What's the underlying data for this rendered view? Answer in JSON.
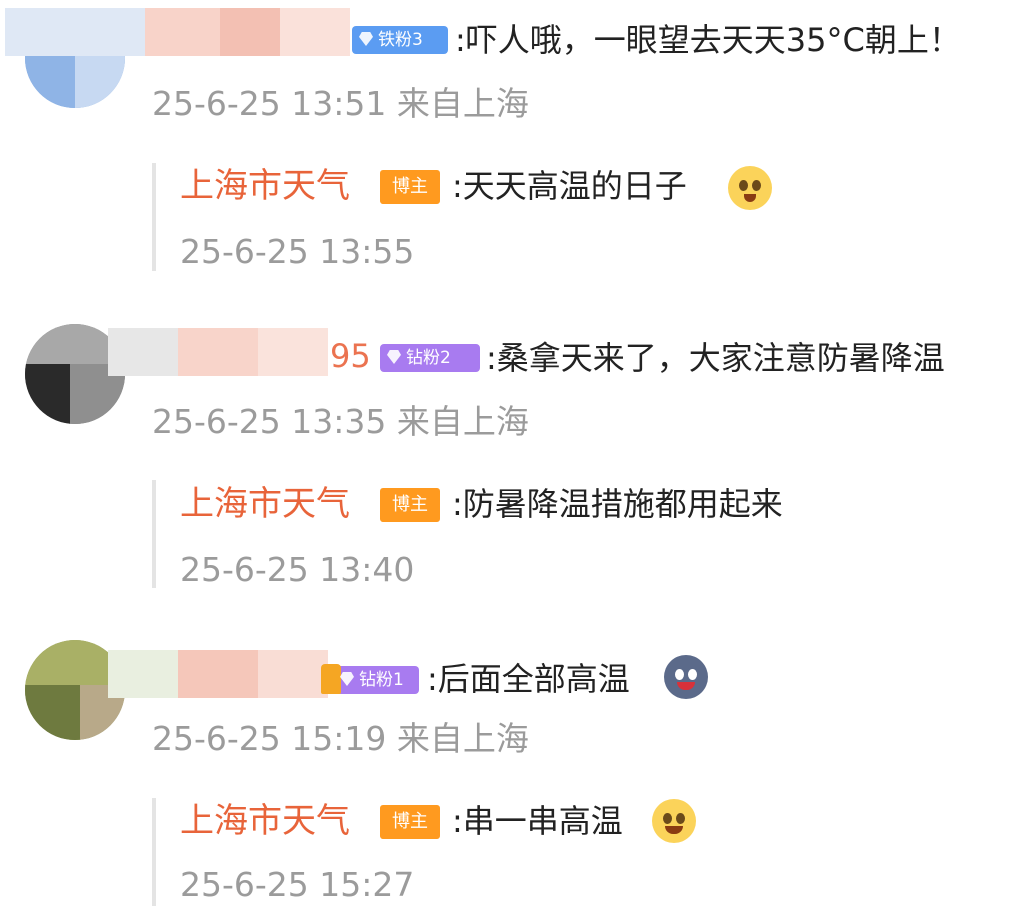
{
  "comments": [
    {
      "badge": "铁粉3",
      "text": ":吓人哦，一眼望去天天35°C朝上！",
      "meta": "25-6-25 13:51 来自上海",
      "reply": {
        "author": "上海市天气",
        "badge": "博主",
        "text": ":天天高温的日子",
        "emoji": "pray-hands-emoji",
        "meta": "25-6-25 13:55"
      }
    },
    {
      "name_tail": "95",
      "badge": "钻粉2",
      "text": ":桑拿天来了，大家注意防暑降温",
      "meta": "25-6-25 13:35 来自上海",
      "reply": {
        "author": "上海市天气",
        "badge": "博主",
        "text": ":防暑降温措施都用起来",
        "meta": "25-6-25 13:40"
      }
    },
    {
      "badge": "钻粉1",
      "text": ":后面全部高温",
      "emoji": "hot-face-emoji",
      "meta": "25-6-25 15:19 来自上海",
      "reply": {
        "author": "上海市天气",
        "badge": "博主",
        "text": ":串一串高温",
        "emoji": "smiling-face-emoji",
        "meta": "25-6-25 15:27"
      }
    }
  ],
  "colors": {
    "fan_badge_iron": "#5b9cf2",
    "fan_badge_diamond": "#a87bf0",
    "host_badge": "#ff9a1f",
    "author_name": "#e8643a",
    "meta_text": "#9b9b9b"
  }
}
